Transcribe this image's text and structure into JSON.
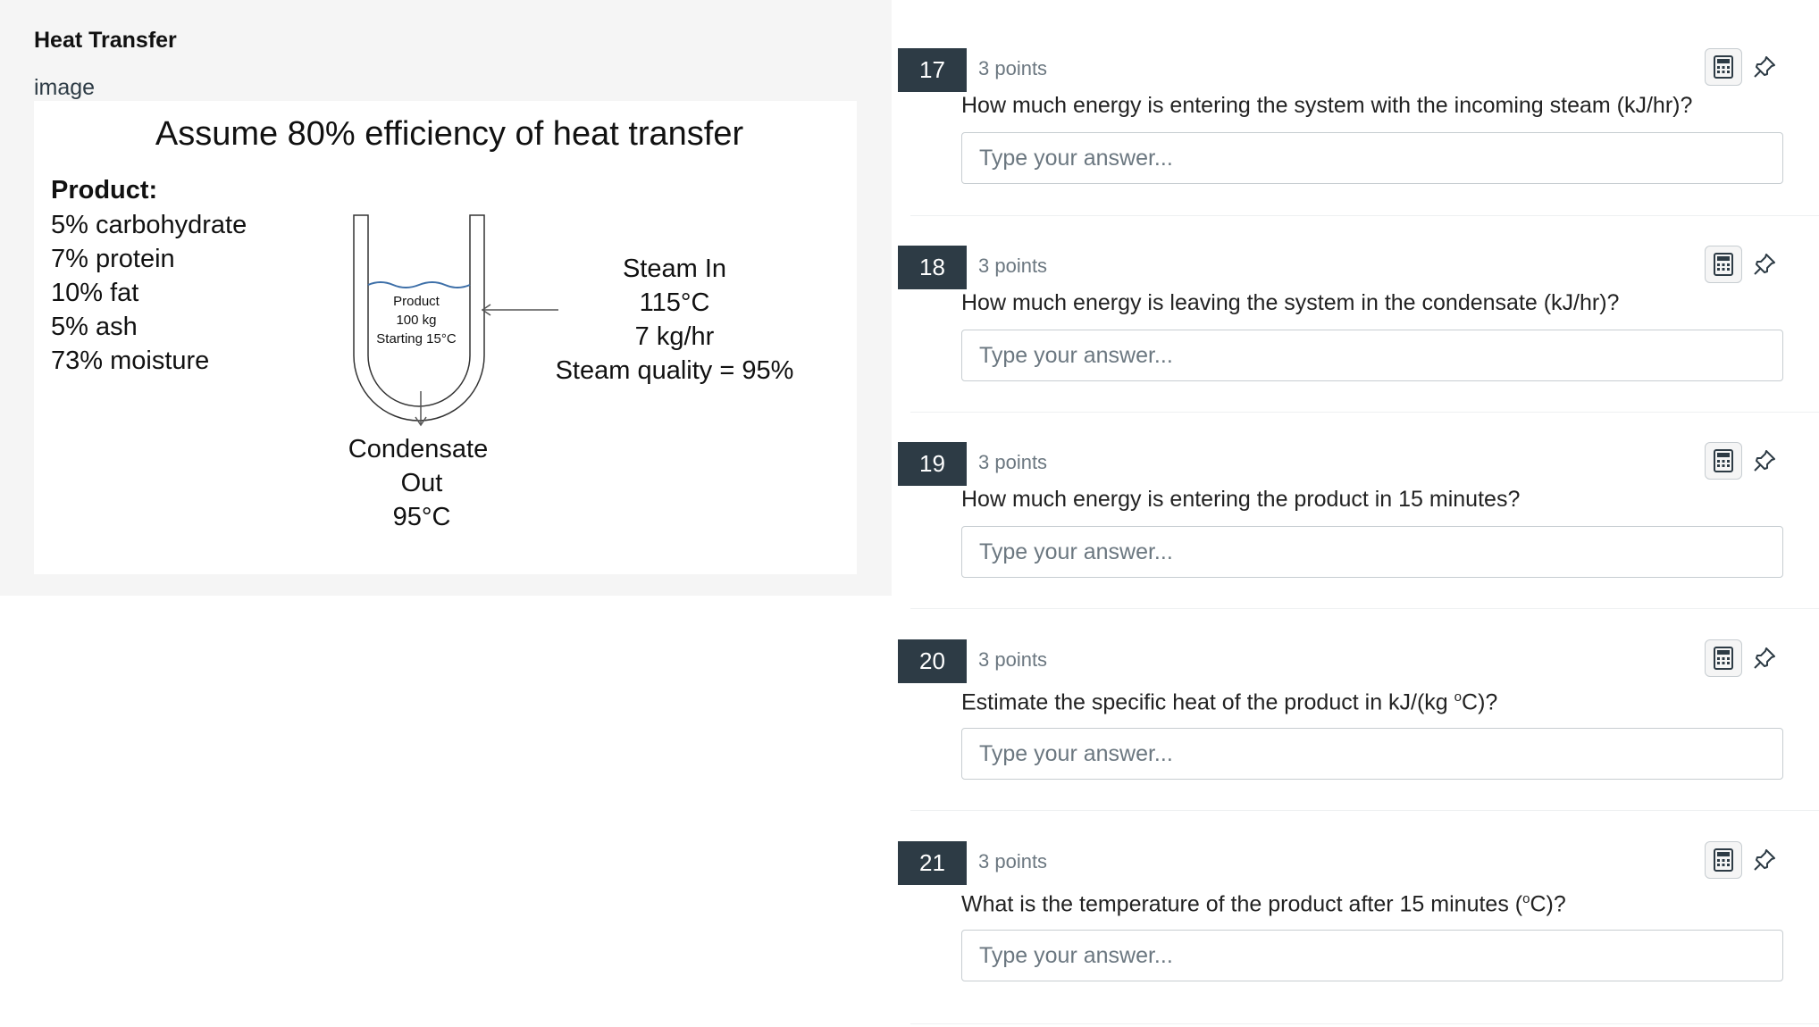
{
  "passage": {
    "title": "Heat Transfer",
    "caption": "image",
    "figure": {
      "heading": "Assume 80% efficiency of heat transfer",
      "product_heading": "Product:",
      "product_items": [
        "5% carbohydrate",
        "7% protein",
        "10% fat",
        "5% ash",
        "73% moisture"
      ],
      "vessel_label": [
        "Product",
        "100 kg",
        "Starting 15°C"
      ],
      "steam_lines": [
        "Steam In",
        "115°C",
        "7 kg/hr",
        "Steam quality = 95%"
      ],
      "condensate_lines": [
        "Condensate",
        "Out",
        "95°C"
      ]
    }
  },
  "questions": [
    {
      "number": "17",
      "points": "3 points",
      "text": "How much energy is entering the system with the incoming steam  (kJ/hr)?",
      "placeholder": "Type your answer..."
    },
    {
      "number": "18",
      "points": "3 points",
      "text": "How much energy is leaving the system in the condensate (kJ/hr)?",
      "placeholder": "Type your answer..."
    },
    {
      "number": "19",
      "points": "3 points",
      "text": "How much energy is entering the product in 15 minutes?",
      "placeholder": "Type your answer..."
    },
    {
      "number": "20",
      "points": "3 points",
      "text_before": "Estimate the specific heat of the product in kJ/(kg ",
      "text_sup": "o",
      "text_after": "C)?",
      "placeholder": "Type your answer..."
    },
    {
      "number": "21",
      "points": "3 points",
      "text_before": "What is the temperature of the product after 15 minutes (",
      "text_sup": "o",
      "text_after": "C)?",
      "placeholder": "Type your answer..."
    }
  ],
  "icons": {
    "calculator": "calculator-icon",
    "pin": "pin-icon"
  }
}
